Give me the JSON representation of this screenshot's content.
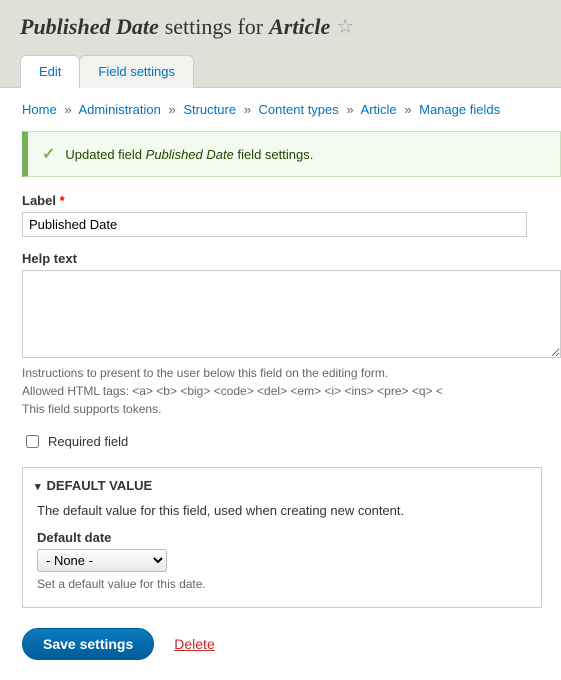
{
  "page_title": {
    "field_name": "Published Date",
    "middle": "settings for",
    "entity_type": "Article"
  },
  "tabs": [
    {
      "label": "Edit",
      "active": true
    },
    {
      "label": "Field settings",
      "active": false
    }
  ],
  "breadcrumb": {
    "items": [
      "Home",
      "Administration",
      "Structure",
      "Content types",
      "Article",
      "Manage fields"
    ],
    "separator": "»"
  },
  "status_message": {
    "prefix": "Updated field",
    "field_name": "Published Date",
    "suffix": "field settings."
  },
  "form": {
    "label_field": {
      "label": "Label",
      "required": true,
      "value": "Published Date"
    },
    "help_text": {
      "label": "Help text",
      "value": "",
      "desc_line1": "Instructions to present to the user below this field on the editing form.",
      "desc_line2_prefix": "Allowed HTML tags: ",
      "desc_line2_tags": "<a> <b> <big> <code> <del> <em> <i> <ins> <pre> <q> <",
      "desc_line3": "This field supports tokens."
    },
    "required_checkbox": {
      "label": "Required field",
      "checked": false
    },
    "default_value": {
      "legend": "DEFAULT VALUE",
      "description": "The default value for this field, used when creating new content.",
      "default_date_label": "Default date",
      "selected": "- None -",
      "hint": "Set a default value for this date."
    },
    "actions": {
      "save": "Save settings",
      "delete": "Delete"
    }
  }
}
